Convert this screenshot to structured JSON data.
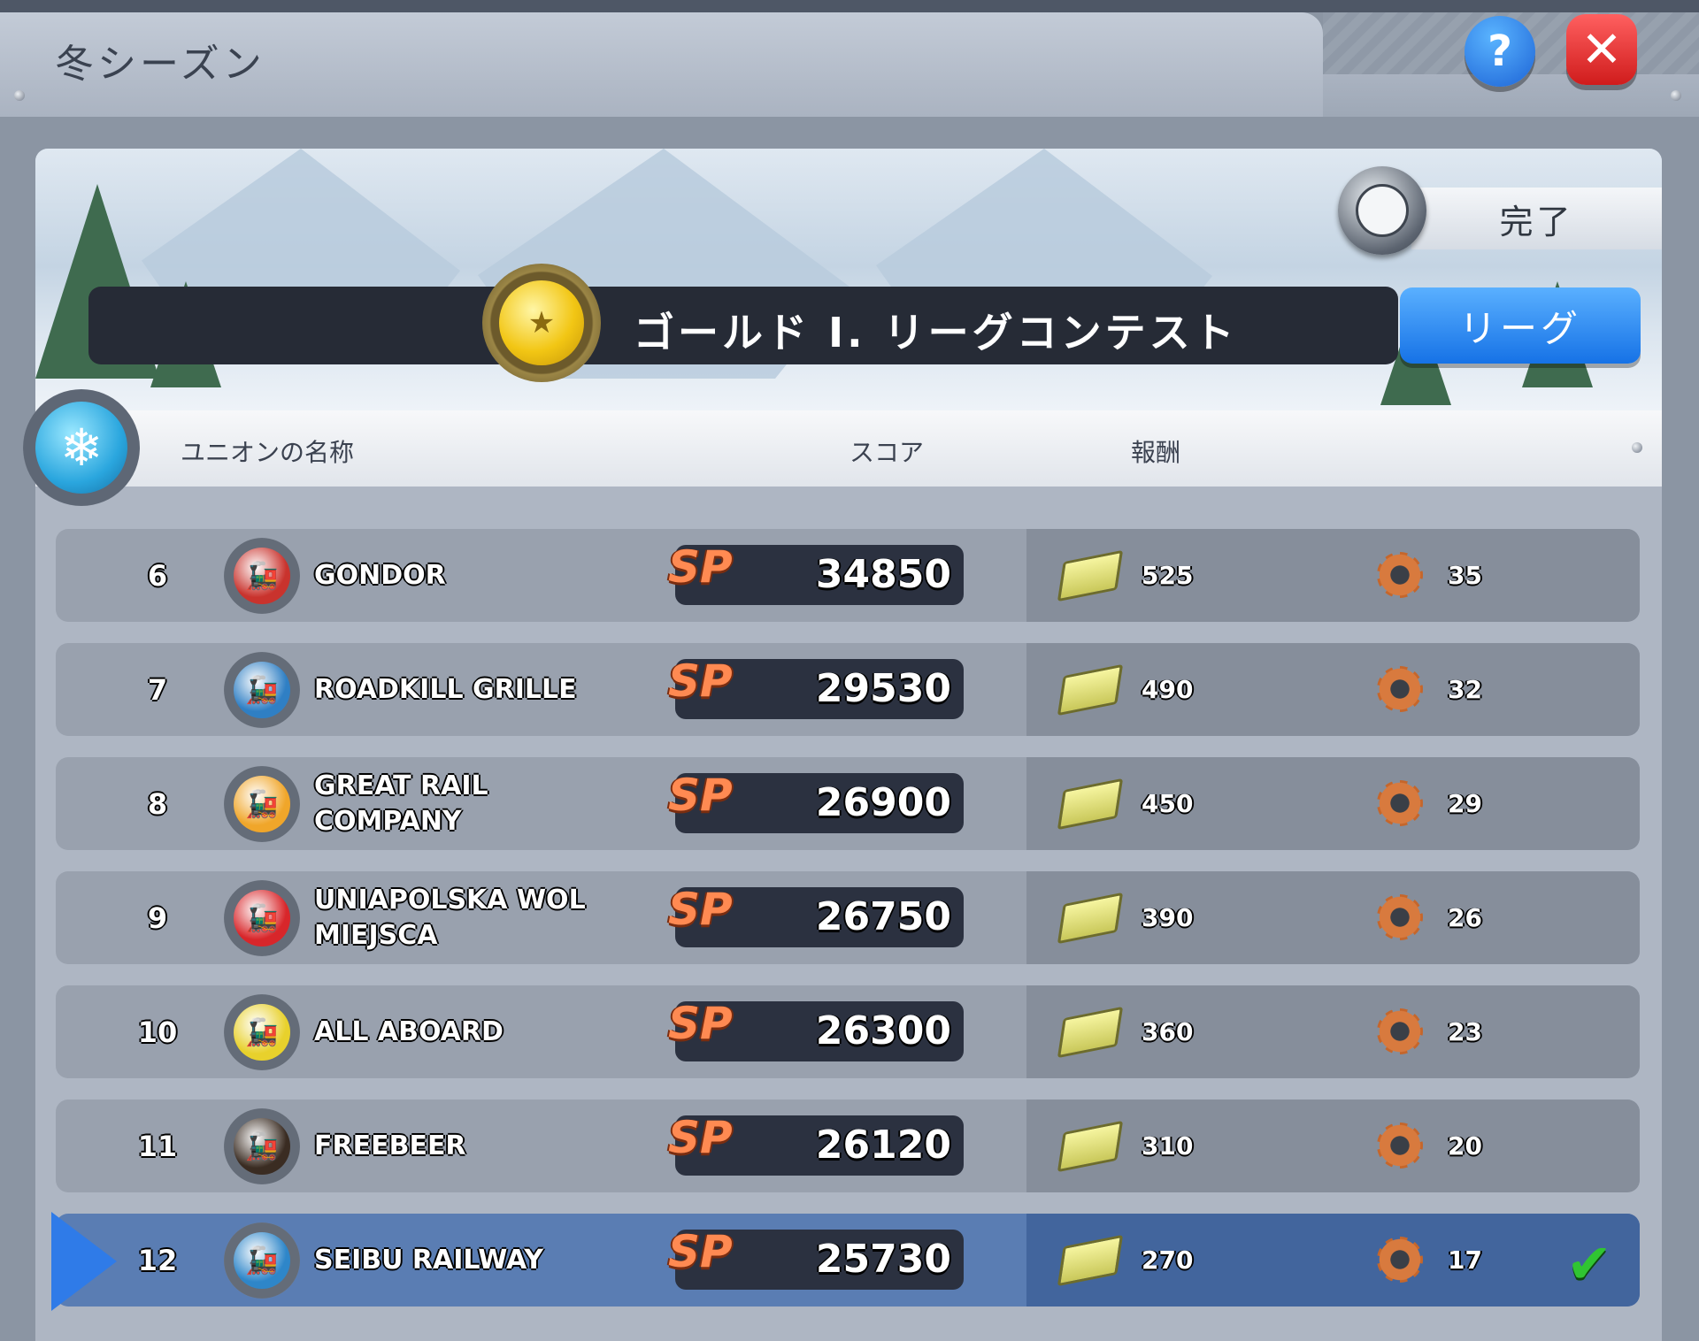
{
  "window": {
    "title": "冬シーズン",
    "help_label": "?",
    "close_label": "✕"
  },
  "banner": {
    "status": "完了",
    "league_title": "ゴールド I. リーグコンテスト",
    "league_button": "リーグ",
    "medal_icon": "gold-medal-icon",
    "season_icon": "snowflake-icon"
  },
  "table": {
    "headers": {
      "name": "ユニオンの名称",
      "score": "スコア",
      "reward": "報酬"
    },
    "sp_label": "SP",
    "rows": [
      {
        "rank": "6",
        "name": "GONDOR",
        "score": "34850",
        "cash": "525",
        "gears": "35",
        "avatar_color": "#c9332d"
      },
      {
        "rank": "7",
        "name": "ROADKILL GRILLE",
        "score": "29530",
        "cash": "490",
        "gears": "32",
        "avatar_color": "#2f7fc4"
      },
      {
        "rank": "8",
        "name": "GREAT RAIL COMPANY",
        "score": "26900",
        "cash": "450",
        "gears": "29",
        "avatar_color": "#f0a62a"
      },
      {
        "rank": "9",
        "name": "UNIAPOLSKA WOL MIEJSCA",
        "score": "26750",
        "cash": "390",
        "gears": "26",
        "avatar_color": "#d8262a"
      },
      {
        "rank": "10",
        "name": "ALL ABOARD",
        "score": "26300",
        "cash": "360",
        "gears": "23",
        "avatar_color": "#e8d12c"
      },
      {
        "rank": "11",
        "name": "FREEBEER",
        "score": "26120",
        "cash": "310",
        "gears": "20",
        "avatar_color": "#3a2c22"
      },
      {
        "rank": "12",
        "name": "SEIBU RAILWAY",
        "score": "25730",
        "cash": "270",
        "gears": "17",
        "avatar_color": "#2e86c9",
        "is_player": true,
        "claimed": "✔"
      }
    ]
  }
}
